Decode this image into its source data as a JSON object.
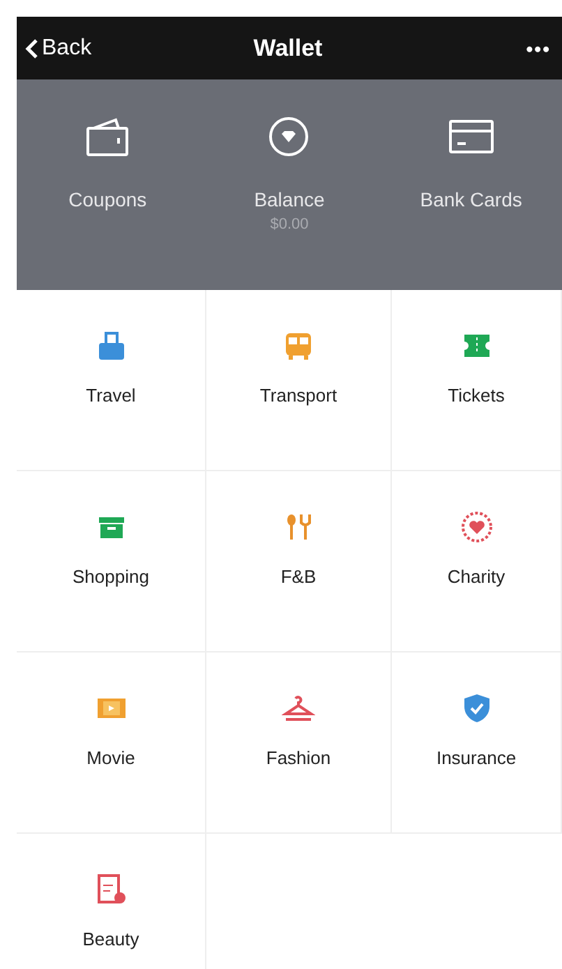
{
  "nav": {
    "back": "Back",
    "title": "Wallet",
    "more": "•••"
  },
  "summary": [
    {
      "kind": "coupons",
      "label": "Coupons"
    },
    {
      "kind": "balance",
      "label": "Balance",
      "sub": "$0.00"
    },
    {
      "kind": "cards",
      "label": "Bank Cards"
    }
  ],
  "services": [
    {
      "kind": "travel",
      "label": "Travel",
      "color": "#3b8fd9"
    },
    {
      "kind": "transport",
      "label": "Transport",
      "color": "#f0a030"
    },
    {
      "kind": "tickets",
      "label": "Tickets",
      "color": "#1fa855"
    },
    {
      "kind": "shopping",
      "label": "Shopping",
      "color": "#1fa855"
    },
    {
      "kind": "food",
      "label": "F&B",
      "color": "#e8912c"
    },
    {
      "kind": "charity",
      "label": "Charity",
      "color": "#e0505a"
    },
    {
      "kind": "movie",
      "label": "Movie",
      "color": "#f0a030"
    },
    {
      "kind": "fashion",
      "label": "Fashion",
      "color": "#e0505a"
    },
    {
      "kind": "insurance",
      "label": "Insurance",
      "color": "#3b8fd9"
    },
    {
      "kind": "beauty",
      "label": "Beauty",
      "color": "#e0505a"
    }
  ]
}
